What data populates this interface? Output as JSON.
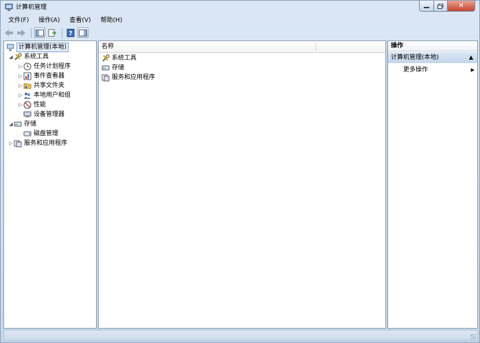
{
  "window": {
    "title": "计算机管理"
  },
  "menu": [
    {
      "label": "文件(F)",
      "name": "menu-file"
    },
    {
      "label": "操作(A)",
      "name": "menu-action"
    },
    {
      "label": "查看(V)",
      "name": "menu-view"
    },
    {
      "label": "帮助(H)",
      "name": "menu-help"
    }
  ],
  "tree": {
    "root": "计算机管理(本地)",
    "system_tools": "系统工具",
    "task_scheduler": "任务计划程序",
    "event_viewer": "事件查看器",
    "shared_folders": "共享文件夹",
    "local_users": "本地用户和组",
    "performance": "性能",
    "device_manager": "设备管理器",
    "storage": "存储",
    "disk_management": "磁盘管理",
    "services_apps": "服务和应用程序"
  },
  "list": {
    "column_name": "名称",
    "items": [
      "系统工具",
      "存储",
      "服务和应用程序"
    ]
  },
  "actions": {
    "header": "操作",
    "section": "计算机管理(本地)",
    "more": "更多操作"
  }
}
